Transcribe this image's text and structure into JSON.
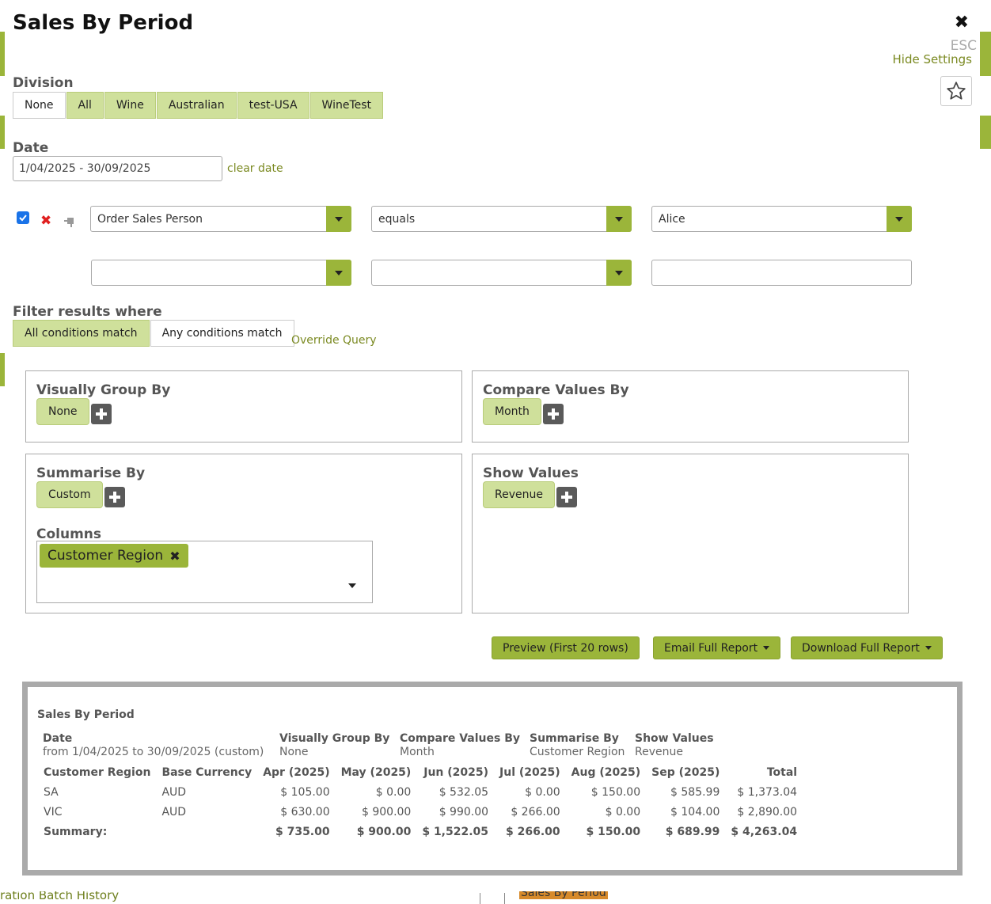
{
  "page": {
    "title": "Sales By Period",
    "close_label": "✖",
    "esc_label": "ESC",
    "hide_settings": "Hide Settings"
  },
  "background": {
    "bottom_left_text": "ration Batch History",
    "bottom_right_text": "Sales By Period"
  },
  "division": {
    "label": "Division",
    "options": [
      "None",
      "All",
      "Wine",
      "Australian",
      "test-USA",
      "WineTest"
    ]
  },
  "date": {
    "label": "Date",
    "value": "1/04/2025 - 30/09/2025",
    "clear_label": "clear date"
  },
  "conditions": [
    {
      "checked": true,
      "field": "Order Sales Person",
      "operator": "equals",
      "value": "Alice"
    },
    {
      "checked": false,
      "field": "",
      "operator": "",
      "value": ""
    }
  ],
  "filter": {
    "label": "Filter results where",
    "all_label": "All conditions match",
    "any_label": "Any conditions match",
    "override_label": "Override Query"
  },
  "panels": {
    "visual_group": {
      "title": "Visually Group By",
      "value": "None"
    },
    "compare": {
      "title": "Compare Values By",
      "value": "Month"
    },
    "summarise": {
      "title": "Summarise By",
      "value": "Custom",
      "columns_label": "Columns",
      "column_tag": "Customer Region"
    },
    "show_values": {
      "title": "Show Values",
      "value": "Revenue"
    }
  },
  "actions": {
    "preview": "Preview (First 20 rows)",
    "email": "Email Full Report",
    "download": "Download Full Report"
  },
  "report": {
    "title": "Sales By Period",
    "meta": {
      "date_h": "Date",
      "date_v": "from 1/04/2025 to 30/09/2025 (custom)",
      "vg_h": "Visually Group By",
      "vg_v": "None",
      "cv_h": "Compare Values By",
      "cv_v": "Month",
      "sb_h": "Summarise By",
      "sb_v": "Customer Region",
      "sv_h": "Show Values",
      "sv_v": "Revenue"
    },
    "columns": [
      "Customer Region",
      "Base Currency",
      "Apr (2025)",
      "May (2025)",
      "Jun (2025)",
      "Jul (2025)",
      "Aug (2025)",
      "Sep (2025)",
      "Total"
    ],
    "rows": [
      [
        "SA",
        "AUD",
        "$ 105.00",
        "$ 0.00",
        "$ 532.05",
        "$ 0.00",
        "$ 150.00",
        "$ 585.99",
        "$ 1,373.04"
      ],
      [
        "VIC",
        "AUD",
        "$ 630.00",
        "$ 900.00",
        "$ 990.00",
        "$ 266.00",
        "$ 0.00",
        "$ 104.00",
        "$ 2,890.00"
      ]
    ],
    "summary": [
      "Summary:",
      "",
      "$ 735.00",
      "$ 900.00",
      "$ 1,522.05",
      "$ 266.00",
      "$ 150.00",
      "$ 689.99",
      "$ 4,263.04"
    ]
  },
  "colors": {
    "accent": "#9bb53a",
    "accent_light": "#cfe09b",
    "link": "#7b8a22"
  }
}
